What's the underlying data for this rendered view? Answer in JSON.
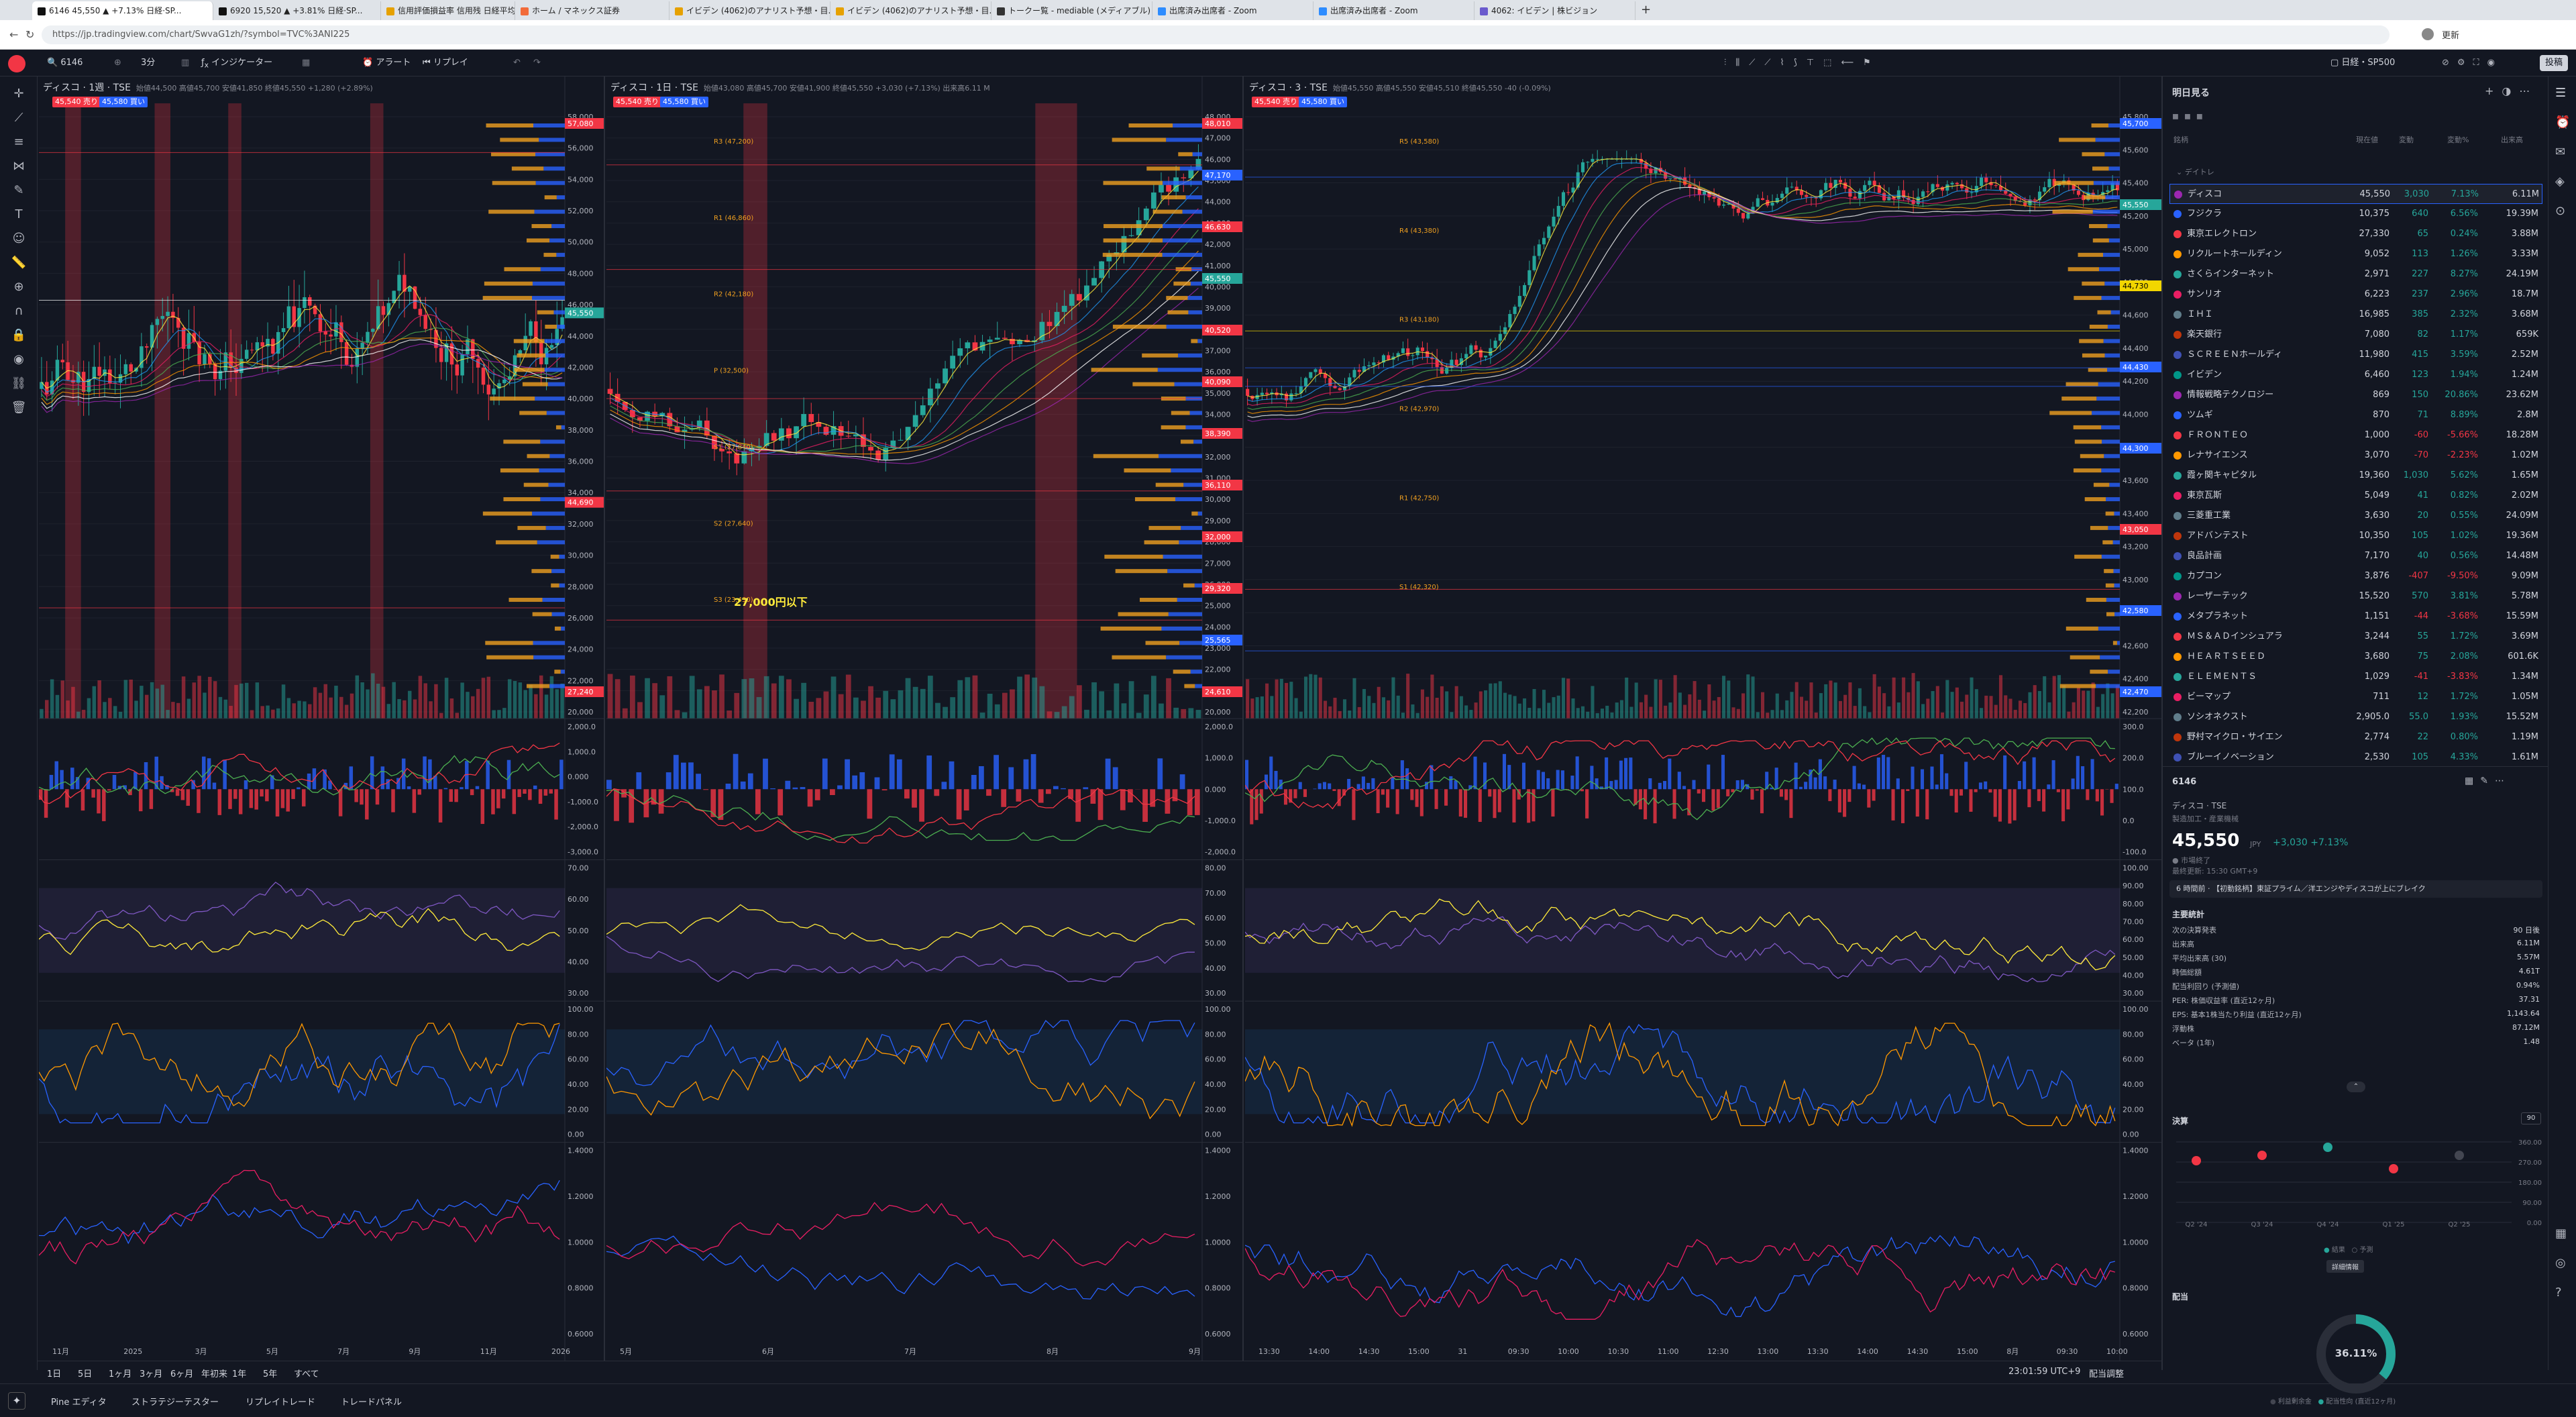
{
  "browser": {
    "tabs": [
      {
        "label": "6146 45,550 ▲ +7.13% 日経·SP..."
      },
      {
        "label": "6920 15,520 ▲ +3.81% 日経·SP..."
      },
      {
        "label": "信用評価損益率 信用残 日経平均..."
      },
      {
        "label": "ホーム / マネックス証券"
      },
      {
        "label": "イビデン (4062)のアナリスト予想・目..."
      },
      {
        "label": "イビデン (4062)のアナリスト予想・目..."
      },
      {
        "label": "トークー覧 - mediable (メディアブル)"
      },
      {
        "label": "出席済み出席者 - Zoom"
      },
      {
        "label": "出席済み出席者 - Zoom"
      },
      {
        "label": "4062: イビデン | 株ビジョン"
      }
    ],
    "url": "https://jp.tradingview.com/chart/SwvaG1zh/?symbol=TVC%3ANI225",
    "profile": "更新"
  },
  "toolbar": {
    "symbol": "6146",
    "interval": "3分",
    "indicators": "インジケーター",
    "alert": "アラート",
    "replay": "リプレイ",
    "index": "日経・SP500",
    "publish": "投稿"
  },
  "panes": [
    {
      "title": "ディスコ · 1週 · TSE",
      "ohlc": "始値44,500 高値45,700 安値41,850 終値45,550 +1,280 (+2.89%)",
      "sell": "45,540",
      "sell_label": "売り",
      "buy": "45,580",
      "buy_label": "買い",
      "prices": [
        "58,000",
        "56,000",
        "54,000",
        "52,000",
        "50,000",
        "48,000",
        "46,000",
        "44,000",
        "42,000",
        "40,000",
        "38,000",
        "36,000",
        "34,000",
        "32,000",
        "30,000",
        "28,000",
        "26,000",
        "24,000",
        "22,000",
        "20,000"
      ],
      "tags": [
        {
          "text": "57,080",
          "color": "#f23645"
        },
        {
          "text": "45,550",
          "color": "#26a69a"
        },
        {
          "text": "44,690",
          "color": "#f23645"
        },
        {
          "text": "27,240",
          "color": "#f23645"
        }
      ],
      "dates": [
        "11月",
        "2025",
        "3月",
        "5月",
        "7月",
        "9月",
        "11月",
        "2026"
      ],
      "macd": [
        "2,000.0",
        "1,000.0",
        "0.000",
        "-1,000.0",
        "-2,000.0",
        "-3,000.0"
      ],
      "rsi": [
        "70.00",
        "60.00",
        "50.00",
        "40.00",
        "30.00"
      ],
      "stoch": [
        "100.00",
        "80.00",
        "60.00",
        "40.00",
        "20.00",
        "0.00"
      ],
      "ratio": [
        "1.4000",
        "1.2000",
        "1.0000",
        "0.8000",
        "0.6000"
      ]
    },
    {
      "title": "ディスコ · 1日 · TSE",
      "ohlc": "始値43,080 高値45,700 安値41,900 終値45,550 +3,030 (+7.13%) 出来高6.11 M",
      "sell": "45,540",
      "sell_label": "売り",
      "buy": "45,580",
      "buy_label": "買い",
      "prices": [
        "48,000",
        "47,000",
        "46,000",
        "45,000",
        "44,000",
        "43,000",
        "42,000",
        "41,000",
        "40,000",
        "39,000",
        "38,000",
        "37,000",
        "36,000",
        "35,000",
        "34,000",
        "33,000",
        "32,000",
        "31,000",
        "30,000",
        "29,000",
        "28,000",
        "27,000",
        "26,000",
        "25,000",
        "24,000",
        "23,000",
        "22,000",
        "21,000",
        "20,000"
      ],
      "tags": [
        {
          "text": "48,010",
          "color": "#f23645"
        },
        {
          "text": "47,170",
          "color": "#2962ff"
        },
        {
          "text": "46,630",
          "color": "#f23645"
        },
        {
          "text": "45,550",
          "color": "#26a69a"
        },
        {
          "text": "40,520",
          "color": "#f23645"
        },
        {
          "text": "40,090",
          "color": "#f23645"
        },
        {
          "text": "38,390",
          "color": "#f23645"
        },
        {
          "text": "36,110",
          "color": "#f23645"
        },
        {
          "text": "32,000",
          "color": "#f23645"
        },
        {
          "text": "29,320",
          "color": "#f23645"
        },
        {
          "text": "25,565",
          "color": "#2962ff"
        },
        {
          "text": "24,610",
          "color": "#f23645"
        }
      ],
      "annotation": "27,000円以下",
      "pivots": [
        "R3 (47,200)",
        "R1 (46,860)",
        "R2 (42,180)",
        "P (32,500)",
        "S1 (27,840)",
        "S2 (27,640)",
        "S3 (23,430)"
      ],
      "dates": [
        "5月",
        "6月",
        "7月",
        "8月",
        "9月"
      ],
      "macd": [
        "2,000.0",
        "1,000.0",
        "0.000",
        "-1,000.0",
        "-2,000.0"
      ],
      "rsi": [
        "80.00",
        "70.00",
        "60.00",
        "50.00",
        "40.00",
        "30.00"
      ],
      "stoch": [
        "100.00",
        "80.00",
        "60.00",
        "40.00",
        "20.00",
        "0.00"
      ],
      "ratio": [
        "1.4000",
        "1.2000",
        "1.0000",
        "0.8000",
        "0.6000"
      ]
    },
    {
      "title": "ディスコ · 3 · TSE",
      "ohlc": "始値45,550 高値45,550 安値45,510 終値45,550 -40 (-0.09%)",
      "sell": "45,540",
      "sell_label": "売り",
      "buy": "45,580",
      "buy_label": "買い",
      "prices": [
        "45,800",
        "45,600",
        "45,400",
        "45,200",
        "45,000",
        "44,800",
        "44,600",
        "44,400",
        "44,200",
        "44,000",
        "43,800",
        "43,600",
        "43,400",
        "43,200",
        "43,000",
        "42,800",
        "42,600",
        "42,400",
        "42,200"
      ],
      "tags": [
        {
          "text": "45,700",
          "color": "#2962ff"
        },
        {
          "text": "45,550",
          "color": "#26a69a"
        },
        {
          "text": "44,730",
          "color": "#f2d600"
        },
        {
          "text": "44,430",
          "color": "#2962ff"
        },
        {
          "text": "44,300",
          "color": "#2962ff"
        },
        {
          "text": "43,050",
          "color": "#f23645"
        },
        {
          "text": "42,580",
          "color": "#2962ff"
        },
        {
          "text": "42,470",
          "color": "#2962ff"
        }
      ],
      "pivots": [
        "R5 (43,580)",
        "R4 (43,380)",
        "R3 (43,180)",
        "R2 (42,970)",
        "R1 (42,750)",
        "S1 (42,320)"
      ],
      "dates": [
        "13:30",
        "14:00",
        "14:30",
        "15:00",
        "31",
        "09:30",
        "10:00",
        "10:30",
        "11:00",
        "12:30",
        "13:00",
        "13:30",
        "14:00",
        "14:30",
        "15:00",
        "8月",
        "09:30",
        "10:00"
      ],
      "macd": [
        "300.0",
        "200.0",
        "100.0",
        "0.0",
        "-100.0"
      ],
      "rsi": [
        "100.00",
        "90.00",
        "80.00",
        "70.00",
        "60.00",
        "50.00",
        "40.00",
        "30.00"
      ],
      "stoch": [
        "100.00",
        "80.00",
        "60.00",
        "40.00",
        "20.00",
        "0.00"
      ],
      "ratio": [
        "1.4000",
        "1.2000",
        "1.0000",
        "0.8000",
        "0.6000"
      ]
    }
  ],
  "bottom": {
    "ranges": [
      "1日",
      "5日",
      "1ヶ月",
      "3ヶ月",
      "6ヶ月",
      "年初来",
      "1年",
      "5年",
      "すべて"
    ],
    "clock": "23:01:59 UTC+9",
    "adjust": "配当調整",
    "panels": [
      "Pine エディタ",
      "ストラテジーテスター",
      "リプレイトレード",
      "トレードパネル"
    ]
  },
  "watchlist": {
    "title": "明日見る",
    "columns": [
      "銘柄",
      "現在値",
      "変動",
      "変動%",
      "出来高"
    ],
    "section": "デイトレ",
    "rows": [
      {
        "name": "ディスコ",
        "price": "45,550",
        "chg": "3,030",
        "pct": "7.13%",
        "vol": "6.11M",
        "dir": "pos"
      },
      {
        "name": "フジクラ",
        "price": "10,375",
        "chg": "640",
        "pct": "6.56%",
        "vol": "19.39M",
        "dir": "pos"
      },
      {
        "name": "東京エレクトロン",
        "price": "27,330",
        "chg": "65",
        "pct": "0.24%",
        "vol": "3.88M",
        "dir": "pos"
      },
      {
        "name": "リクルートホールディン",
        "price": "9,052",
        "chg": "113",
        "pct": "1.26%",
        "vol": "3.33M",
        "dir": "pos"
      },
      {
        "name": "さくらインターネット",
        "price": "2,971",
        "chg": "227",
        "pct": "8.27%",
        "vol": "24.19M",
        "dir": "pos"
      },
      {
        "name": "サンリオ",
        "price": "6,223",
        "chg": "237",
        "pct": "2.96%",
        "vol": "18.7M",
        "dir": "pos"
      },
      {
        "name": "ＩＨＩ",
        "price": "16,985",
        "chg": "385",
        "pct": "2.32%",
        "vol": "3.68M",
        "dir": "pos"
      },
      {
        "name": "楽天銀行",
        "price": "7,080",
        "chg": "82",
        "pct": "1.17%",
        "vol": "659K",
        "dir": "pos"
      },
      {
        "name": "ＳＣＲＥＥＮホールディ",
        "price": "11,980",
        "chg": "415",
        "pct": "3.59%",
        "vol": "2.52M",
        "dir": "pos"
      },
      {
        "name": "イビデン",
        "price": "6,460",
        "chg": "123",
        "pct": "1.94%",
        "vol": "1.24M",
        "dir": "pos"
      },
      {
        "name": "情報戦略テクノロジー",
        "price": "869",
        "chg": "150",
        "pct": "20.86%",
        "vol": "23.62M",
        "dir": "pos"
      },
      {
        "name": "ツムギ",
        "price": "870",
        "chg": "71",
        "pct": "8.89%",
        "vol": "2.8M",
        "dir": "pos"
      },
      {
        "name": "ＦＲＯＮＴＥＯ",
        "price": "1,000",
        "chg": "-60",
        "pct": "-5.66%",
        "vol": "18.28M",
        "dir": "neg"
      },
      {
        "name": "レナサイエンス",
        "price": "3,070",
        "chg": "-70",
        "pct": "-2.23%",
        "vol": "1.02M",
        "dir": "neg"
      },
      {
        "name": "霞ヶ関キャピタル",
        "price": "19,360",
        "chg": "1,030",
        "pct": "5.62%",
        "vol": "1.65M",
        "dir": "pos"
      },
      {
        "name": "東京瓦斯",
        "price": "5,049",
        "chg": "41",
        "pct": "0.82%",
        "vol": "2.02M",
        "dir": "pos"
      },
      {
        "name": "三菱重工業",
        "price": "3,630",
        "chg": "20",
        "pct": "0.55%",
        "vol": "24.09M",
        "dir": "pos"
      },
      {
        "name": "アドバンテスト",
        "price": "10,350",
        "chg": "105",
        "pct": "1.02%",
        "vol": "19.36M",
        "dir": "pos"
      },
      {
        "name": "良品計画",
        "price": "7,170",
        "chg": "40",
        "pct": "0.56%",
        "vol": "14.48M",
        "dir": "pos"
      },
      {
        "name": "カプコン",
        "price": "3,876",
        "chg": "-407",
        "pct": "-9.50%",
        "vol": "9.09M",
        "dir": "neg"
      },
      {
        "name": "レーザーテック",
        "price": "15,520",
        "chg": "570",
        "pct": "3.81%",
        "vol": "5.78M",
        "dir": "pos"
      },
      {
        "name": "メタプラネット",
        "price": "1,151",
        "chg": "-44",
        "pct": "-3.68%",
        "vol": "15.59M",
        "dir": "neg"
      },
      {
        "name": "ＭＳ＆ＡＤインシュアラ",
        "price": "3,244",
        "chg": "55",
        "pct": "1.72%",
        "vol": "3.69M",
        "dir": "pos"
      },
      {
        "name": "ＨＥＡＲＴＳＥＥＤ",
        "price": "3,680",
        "chg": "75",
        "pct": "2.08%",
        "vol": "601.6K",
        "dir": "pos"
      },
      {
        "name": "ＥＬＥＭＥＮＴＳ",
        "price": "1,029",
        "chg": "-41",
        "pct": "-3.83%",
        "vol": "1.34M",
        "dir": "neg"
      },
      {
        "name": "ビーマップ",
        "price": "711",
        "chg": "12",
        "pct": "1.72%",
        "vol": "1.05M",
        "dir": "pos"
      },
      {
        "name": "ソシオネクスト",
        "price": "2,905.0",
        "chg": "55.0",
        "pct": "1.93%",
        "vol": "15.52M",
        "dir": "pos"
      },
      {
        "name": "野村マイクロ・サイエン",
        "price": "2,774",
        "chg": "22",
        "pct": "0.80%",
        "vol": "1.19M",
        "dir": "pos"
      },
      {
        "name": "ブルーイノベーション",
        "price": "2,530",
        "chg": "105",
        "pct": "4.33%",
        "vol": "1.61M",
        "dir": "pos"
      }
    ]
  },
  "details": {
    "symbol": "6146",
    "name": "ディスコ",
    "exchange": "TSE",
    "sector": "製造加工・産業機械",
    "price": "45,550",
    "currency": "JPY",
    "change": "+3,030",
    "change_pct": "+7.13%",
    "market_status": "市場終了",
    "last_update": "最終更新: 15:30 GMT+9",
    "news": "6 時間前 · 【初動銘柄】東証プライム／洋エンジやディスコが上にブレイク",
    "stats_title": "主要統計",
    "stats": [
      {
        "label": "次の決算発表",
        "value": "90 日後"
      },
      {
        "label": "出来高",
        "value": "6.11M"
      },
      {
        "label": "平均出来高 (30)",
        "value": "5.57M"
      },
      {
        "label": "時価総額",
        "value": "4.61T"
      },
      {
        "label": "配当利回り (予測値)",
        "value": "0.94%"
      },
      {
        "label": "PER: 株価収益率 (直近12ヶ月)",
        "value": "37.31"
      },
      {
        "label": "EPS: 基本1株当たり利益 (直近12ヶ月)",
        "value": "1,143.64"
      },
      {
        "label": "浮動株",
        "value": "87.12M"
      },
      {
        "label": "ベータ (1年)",
        "value": "1.48"
      }
    ],
    "earnings_title": "決算",
    "earnings_period": "90",
    "earnings_y": [
      "360.00",
      "270.00",
      "180.00",
      "90.00",
      "0.00"
    ],
    "earnings_x": [
      "Q2 '24",
      "Q3 '24",
      "Q4 '24",
      "Q1 '25",
      "Q2 '25"
    ],
    "earnings_legend": [
      "結果",
      "予測"
    ],
    "more": "詳細情報",
    "dividend_title": "配当",
    "payout": "36.11%",
    "dividend_legend": [
      "利益剰余金",
      "配当性向 (直近12ヶ月)"
    ]
  }
}
